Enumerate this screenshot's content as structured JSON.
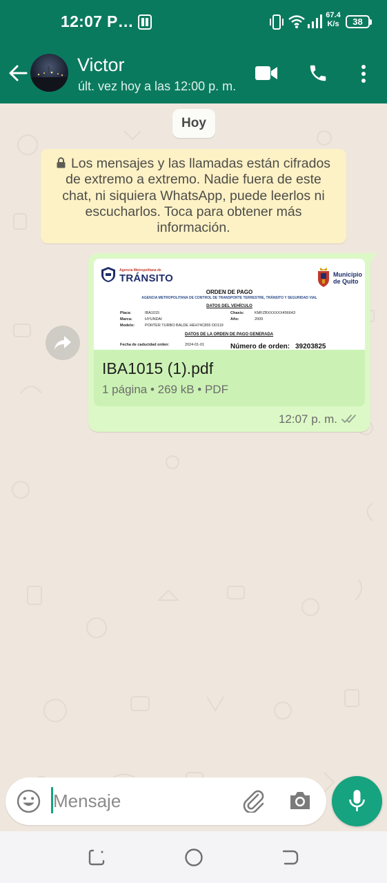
{
  "status_bar": {
    "time": "12:07 P…",
    "net_speed_value": "67.4",
    "net_speed_unit": "K/s",
    "battery": "38"
  },
  "header": {
    "contact_name": "Victor",
    "last_seen": "últ. vez hoy a las 12:00 p. m.",
    "color": "#0a7a5f"
  },
  "chat": {
    "date_chip": "Hoy",
    "encryption_notice": "Los mensajes y las llamadas están cifrados de extremo a extremo. Nadie fuera de este chat, ni siquiera WhatsApp, puede leerlos ni escucharlos. Toca para obtener más información.",
    "message": {
      "file_name": "IBA1015 (1).pdf",
      "file_info": "1 página • 269 kB • PDF",
      "time": "12:07 p. m.",
      "status": "delivered",
      "preview": {
        "agency_small": "Agencia Metropolitana de",
        "agency_big": "TRÁNSITO",
        "municipality": "Municipio de Quito",
        "title": "ORDEN DE PAGO",
        "subtitle": "AGENCIA METROPOLITANA DE CONTROL DE TRANSPORTE TERRESTRE, TRÁNSITO Y SEGURIDAD VIAL",
        "section_vehicle": "DATOS DEL VEHÍCULO",
        "placa_label": "Placa:",
        "placa_value": "IBA1015",
        "chasis_label": "Chasis:",
        "chasis_value": "KMFZBXXXXXX456643",
        "marca_label": "Marca:",
        "marca_value": "HYUNDAI",
        "anio_label": "Año:",
        "anio_value": "2009",
        "modelo_label": "Modelo:",
        "modelo_value": "PORTER TURBO BALDE HEH74C855 DD119",
        "section_order": "DATOS DE LA ORDEN DE PAGO GENERADA",
        "caducidad_label": "Fecha de caducidad orden:",
        "caducidad_value": "2024-01-01",
        "order_label": "Número de orden:",
        "order_value": "39203825"
      }
    }
  },
  "input": {
    "placeholder": "Mensaje"
  },
  "icons": {
    "back": "arrow-left-icon",
    "video": "video-camera-icon",
    "call": "phone-icon",
    "menu": "more-vert-icon",
    "forward": "forward-icon",
    "emoji": "emoji-icon",
    "attach": "paperclip-icon",
    "camera": "camera-icon",
    "mic": "microphone-icon"
  },
  "colors": {
    "accent": "#16a37f",
    "bubble_out": "#dcf8c6",
    "notice_bg": "#fdf1c6",
    "chat_bg": "#efe7de"
  }
}
